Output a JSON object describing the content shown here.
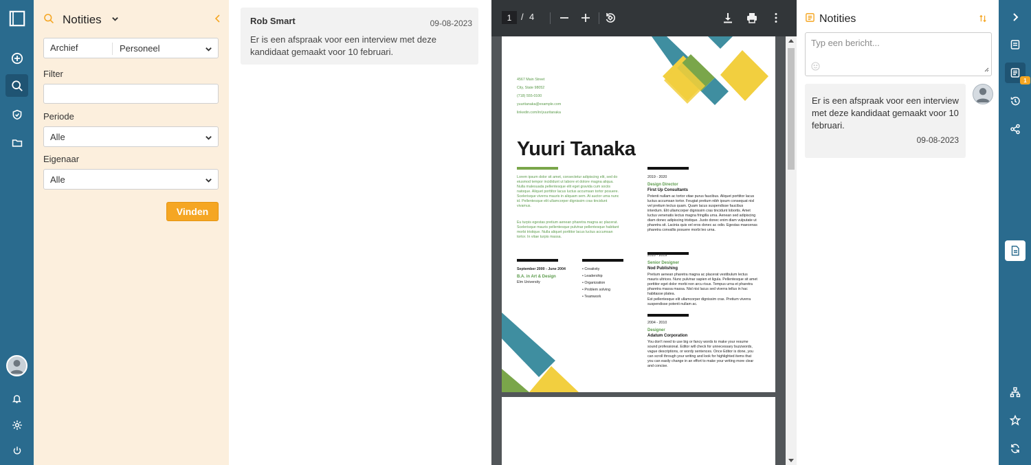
{
  "filter_panel": {
    "title": "Notities",
    "archive_label": "Archief",
    "archive_selected": "Personeel",
    "filter_label": "Filter",
    "filter_value": "",
    "period_label": "Periode",
    "period_selected": "Alle",
    "owner_label": "Eigenaar",
    "owner_selected": "Alle",
    "find_button": "Vinden"
  },
  "notes": [
    {
      "author": "Rob Smart",
      "date": "09-08-2023",
      "text": "Er is een afspraak voor een interview met deze kandidaat gemaakt voor 10 februari."
    }
  ],
  "pdf_viewer": {
    "current_page": "1",
    "separator": "/",
    "total_pages": "4"
  },
  "resume": {
    "address": [
      "4567 Main Street",
      "City, State 98052",
      "(718) 555-0100",
      "yuuritanaka@example.com",
      "linkedin.com/in/yuuritanaka"
    ],
    "name": "Yuuri Tanaka",
    "intro_1": "Lorem ipsum dolor sit amet, consectetur adipiscing elit, sed do eiusmod tempor incididunt ut labore et dolore magna aliqua. Nulla malesuada pellentesque elit eget gravida cum sociis natoque. Aliquet porttitor lacus luctus accumsan tortor posuere. Scelerisque viverra mauris in aliquam sem. At auctor urna nunc id. Pellentesque elit ullamcorper dignissim cras tincidunt vivamus.",
    "intro_2": "Eu turpis egestas pretium aenean pharetra magna ac placerat. Scelerisque mauris pellentesque pulvinar pellentesque habitant morbi tristique. Nulla aliquet porttitor lacus luctus accumsan tortor. In vitae turpis massa.",
    "education_dates": "September 2000 - June 2004",
    "education_degree": "B.A. in Art & Design",
    "education_school": "Elm University",
    "skills": [
      "Creativity",
      "Leadership",
      "Organization",
      "Problem solving",
      "Teamwork"
    ],
    "jobs": [
      {
        "dates": "2019 - 2020",
        "title": "Design Director",
        "company": "First Up Consultants",
        "text": "Potenti nullam ac tortor vitae purus faucibus. Aliquet porttitor lacus luctus accumsan tortor. Feugiat pretium nibh ipsum consequat nisl vel pretium lectus quam. Quam lacus suspendisse faucibus interdum. Elit ullamcorper dignissim cras tincidunt lobortis. Amet luctus venenatis lectus magna fringilla urna. Aenean sed adipiscing diam donec adipiscing tristique. Justo donec enim diam vulputate ut pharetra sit. Lacinia quis vel eros donec ac odio. Egestas maecenas pharetra convallis posuere morbi leo urna."
      },
      {
        "dates": "2010 - 2019",
        "title": "Senior Designer",
        "company": "Nod Publishing",
        "text": "Pretium aenean pharetra magna ac placerat vestibulum lectus mauris ultrices. Nunc pulvinar sapien et ligula. Pellentesque sit amet porttitor eget dolor morbi non arcu risus. Tempus urna et pharetra pharetra massa massa. Nisl nisi lacus sed viverra tellus in hac habitasse platea.",
        "text2": "Est pellentesque elit ullamcorper dignissim cras. Pretium viverra suspendisse potenti nullam ac."
      },
      {
        "dates": "2004 - 2010",
        "title": "Designer",
        "company": "Adatum Corporation",
        "text": "You don't need to use big or fancy words to make your resume sound professional. Editor will check for unnecessary buzzwords, vague descriptions, or wordy sentences. Once Editor is done, you can scroll through your writing and look for highlighted items that you can easily change in an effort to make your writing more clear and concise."
      }
    ]
  },
  "messages": {
    "title": "Notities",
    "input_placeholder": "Typ een bericht...",
    "items": [
      {
        "text": "Er is een afspraak voor een interview met deze kandidaat gemaakt voor 10 februari.",
        "date": "09-08-2023"
      }
    ]
  },
  "right_rail": {
    "notes_badge": "1"
  },
  "colors": {
    "rail": "#2a6b8e",
    "accent": "#f5a623",
    "filter_bg": "#fcefdd"
  }
}
